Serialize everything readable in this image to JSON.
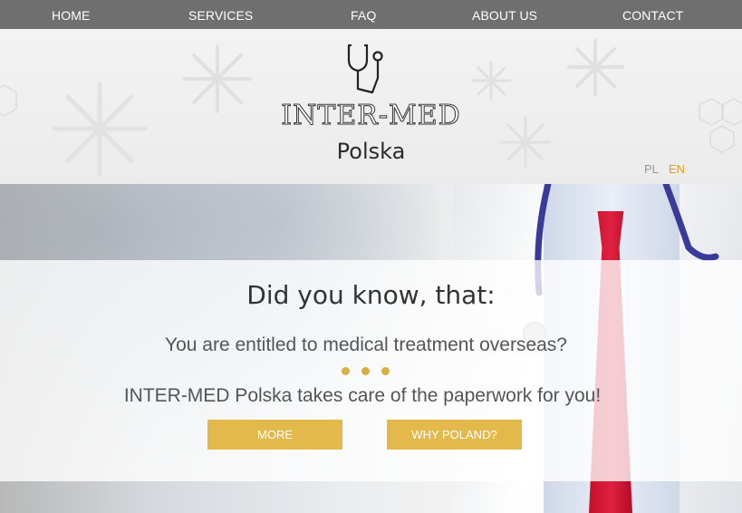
{
  "nav": {
    "items": [
      {
        "label": "HOME"
      },
      {
        "label": "SERVICES"
      },
      {
        "label": "FAQ"
      },
      {
        "label": "ABOUT US"
      },
      {
        "label": "CONTACT"
      }
    ]
  },
  "header": {
    "logo_icon": "stethoscope-icon",
    "brand_title": "INTER-MED",
    "brand_subtitle": "Polska",
    "languages": [
      {
        "code": "PL",
        "active": false
      },
      {
        "code": "EN",
        "active": true
      }
    ],
    "colors": {
      "lang_active": "#e0a020",
      "lang_inactive": "#999999"
    }
  },
  "hero": {
    "heading": "Did you know, that:",
    "line1": "You are entitled to medical treatment overseas?",
    "line2": "INTER-MED Polska takes care of the paperwork for you!",
    "buttons": {
      "more": "MORE",
      "why_poland": "WHY POLAND?"
    },
    "colors": {
      "accent": "#e3b94c",
      "nav_bg": "#6f6f6f"
    }
  }
}
